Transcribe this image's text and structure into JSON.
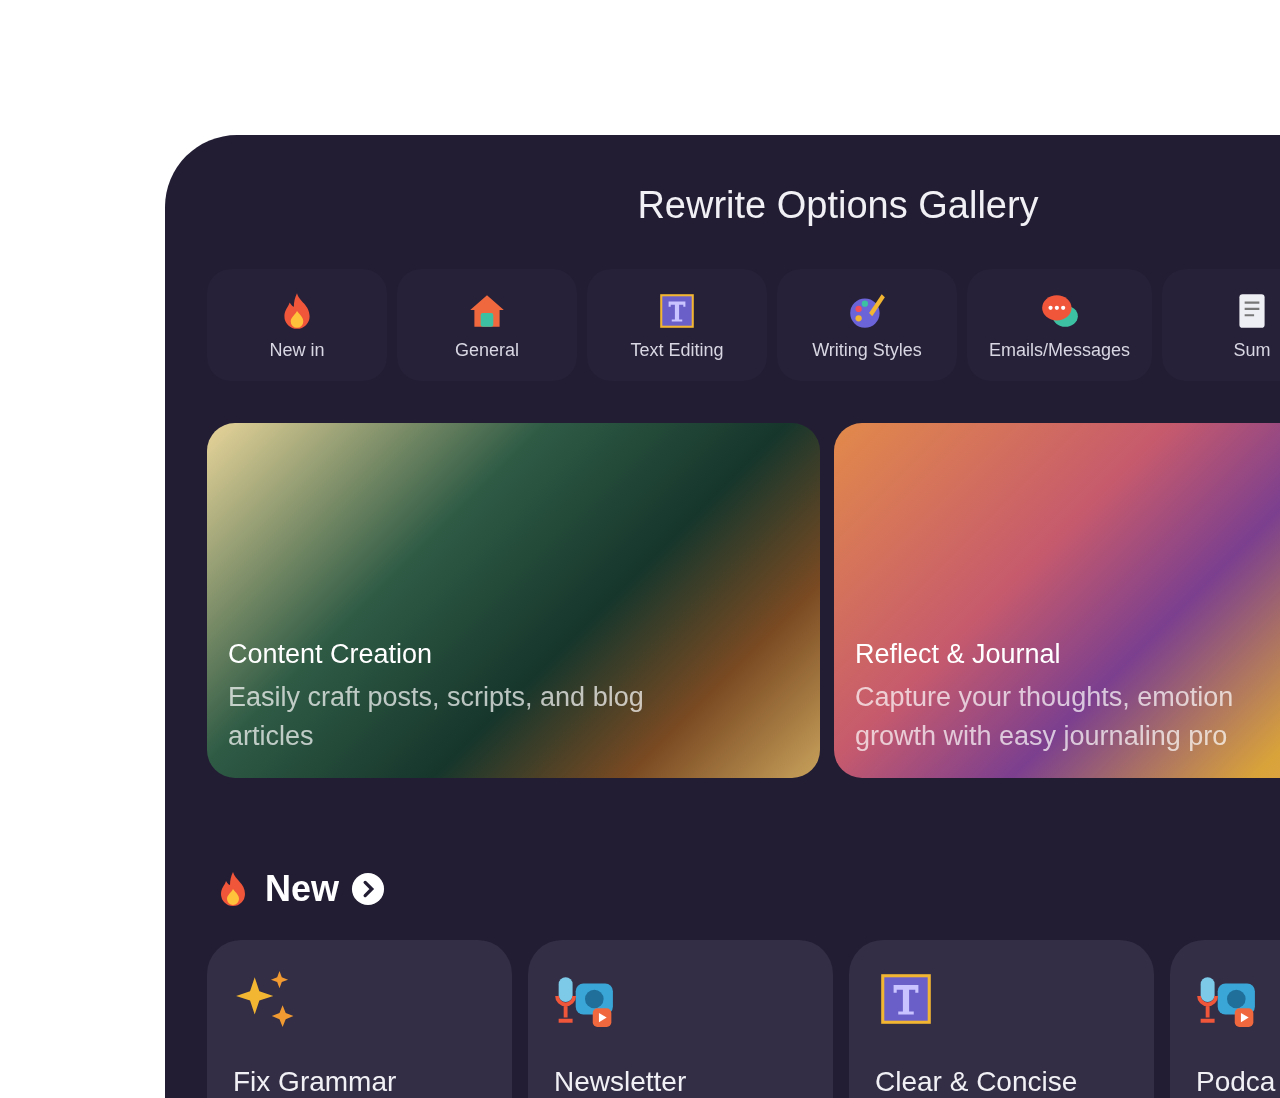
{
  "title": "Rewrite Options Gallery",
  "categories": [
    {
      "label": "New in",
      "kind": "flame"
    },
    {
      "label": "General",
      "kind": "house"
    },
    {
      "label": "Text Editing",
      "kind": "text-frame"
    },
    {
      "label": "Writing Styles",
      "kind": "palette"
    },
    {
      "label": "Emails/Messages",
      "kind": "chat"
    },
    {
      "label": "Sum",
      "kind": "document"
    }
  ],
  "banners": [
    {
      "title": "Content Creation",
      "description_lines": [
        "Easily craft posts, scripts, and blog",
        "articles"
      ],
      "kind": "podcast"
    },
    {
      "title": "Reflect & Journal",
      "description_lines": [
        "Capture your thoughts, emotion",
        "growth with easy journaling pro"
      ],
      "kind": "sunset"
    }
  ],
  "section": {
    "title": "New",
    "kind": "flame"
  },
  "cards": [
    {
      "title": "Fix Grammar",
      "kind": "sparkles"
    },
    {
      "title": "Newsletter",
      "kind": "mic-camera"
    },
    {
      "title": "Clear & Concise",
      "kind": "text-frame"
    },
    {
      "title": "Podca",
      "kind": "mic-camera"
    }
  ]
}
